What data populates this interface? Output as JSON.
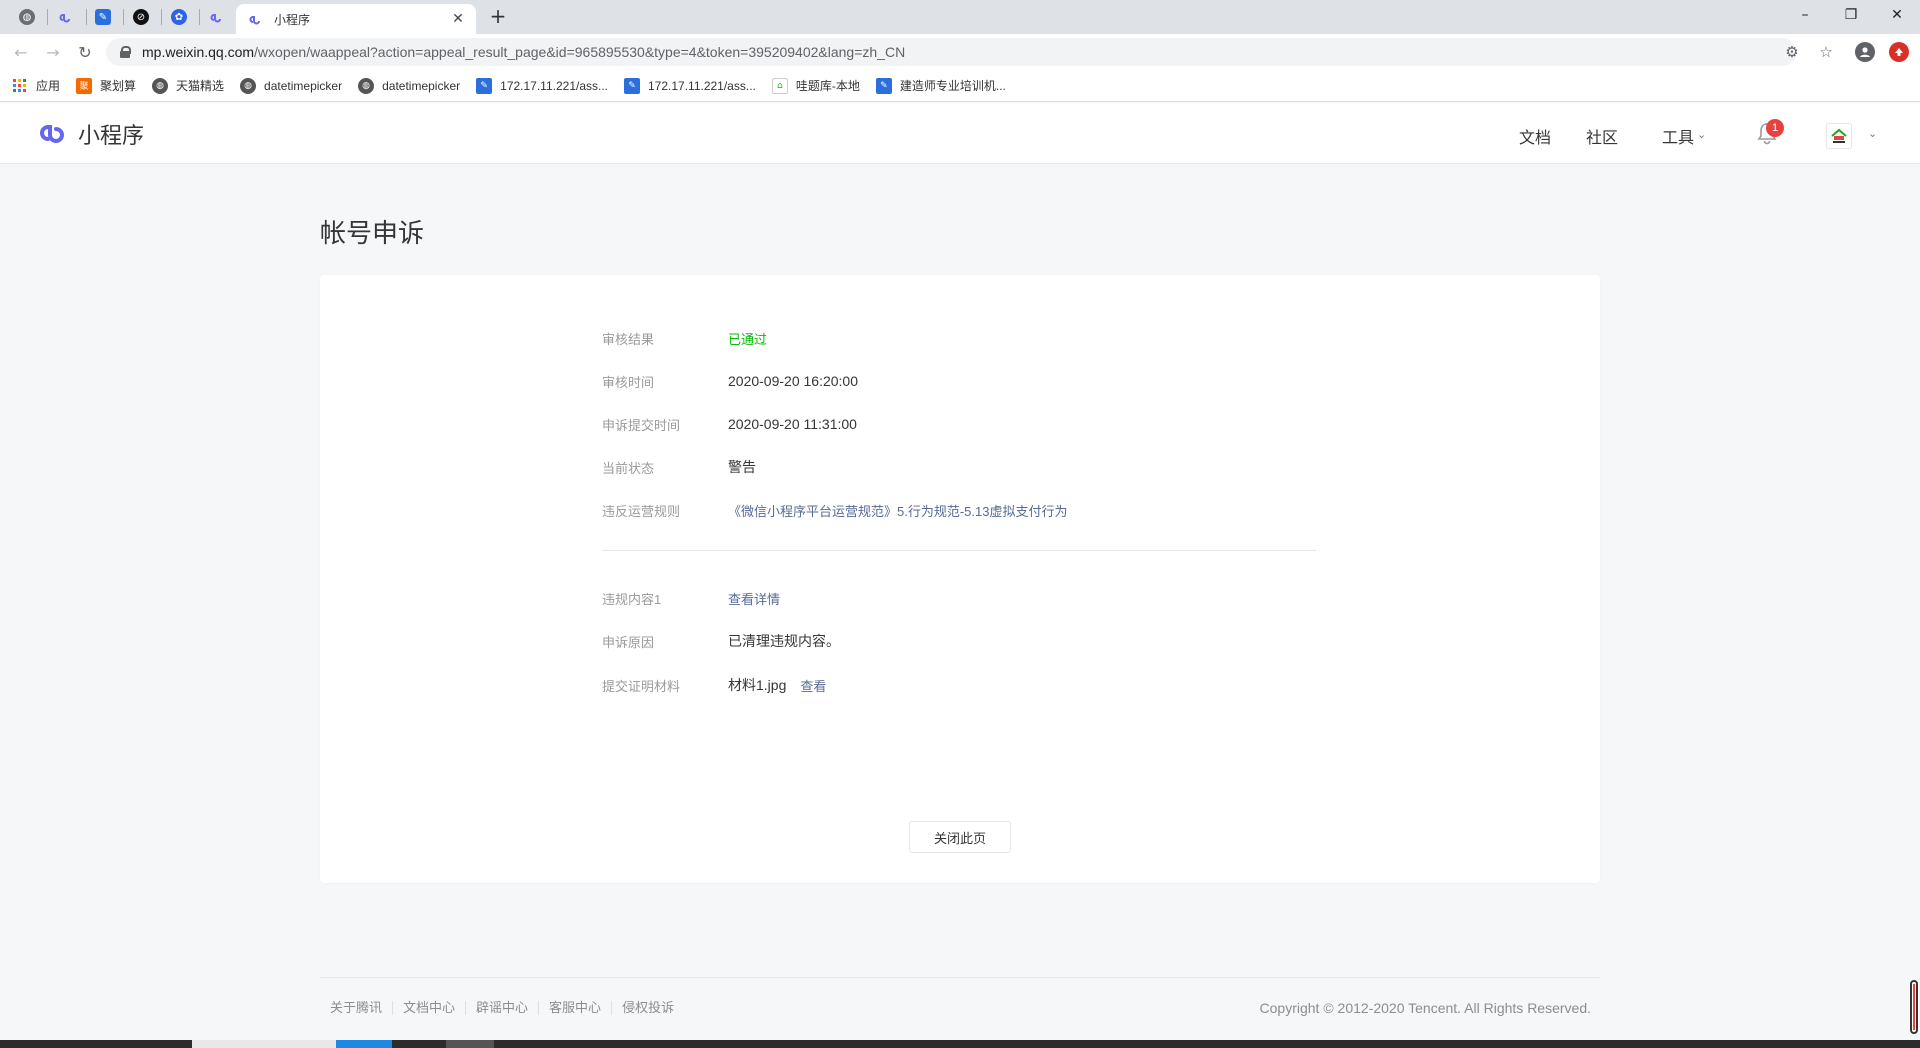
{
  "browser": {
    "tabs": [
      {
        "icon": "globe-icon"
      },
      {
        "icon": "miniprogram-icon"
      },
      {
        "icon": "tool-icon"
      },
      {
        "icon": "compass-icon"
      },
      {
        "icon": "baidu-icon"
      },
      {
        "icon": "miniprogram-icon"
      }
    ],
    "active_tab_title": "小程序",
    "url_host": "mp.weixin.qq.com",
    "url_path": "/wxopen/waappeal?action=appeal_result_page&id=965895530&type=4&token=395209402&lang=zh_CN",
    "bookmarks": [
      {
        "label": "应用",
        "icon": "apps-grid-icon"
      },
      {
        "label": "聚划算",
        "icon": "juhuasuan-icon",
        "color": "#f56a00"
      },
      {
        "label": "天猫精选",
        "icon": "globe-icon"
      },
      {
        "label": "datetimepicker",
        "icon": "globe-icon"
      },
      {
        "label": "datetimepicker",
        "icon": "globe-icon"
      },
      {
        "label": "172.17.11.221/ass...",
        "icon": "tool-icon",
        "color": "#2a6fdb"
      },
      {
        "label": "172.17.11.221/ass...",
        "icon": "tool-icon",
        "color": "#2a6fdb"
      },
      {
        "label": "哇题库-本地",
        "icon": "wtiku-icon"
      },
      {
        "label": "建造师专业培训机...",
        "icon": "tool-icon",
        "color": "#2a6fdb"
      }
    ]
  },
  "site": {
    "brand": "小程序",
    "nav": {
      "docs": "文档",
      "community": "社区",
      "tools": "工具"
    },
    "notification_count": "1"
  },
  "page": {
    "title": "帐号申诉",
    "fields": [
      {
        "label": "审核结果",
        "value": "已通过"
      },
      {
        "label": "审核时间",
        "value": "2020-09-20 16:20:00"
      },
      {
        "label": "申诉提交时间",
        "value": "2020-09-20 11:31:00"
      },
      {
        "label": "当前状态",
        "value": "警告"
      },
      {
        "label": "违反运营规则",
        "value": "《微信小程序平台运营规范》5.行为规范-5.13虚拟支付行为"
      }
    ],
    "details": [
      {
        "label": "违规内容1",
        "value": "查看详情"
      },
      {
        "label": "申诉原因",
        "value": "已清理违规内容。"
      },
      {
        "label": "提交证明材料",
        "value": "材料1.jpg",
        "link": "查看"
      }
    ],
    "close_button": "关闭此页"
  },
  "footer": {
    "links": [
      "关于腾讯",
      "文档中心",
      "辟谣中心",
      "客服中心",
      "侵权投诉"
    ],
    "copyright": "Copyright © 2012-2020 Tencent. All Rights Reserved."
  },
  "colors": {
    "accent_link": "#576b95",
    "success": "#09bb07",
    "badge": "#e64340",
    "brand_purple": "#6467f0"
  }
}
